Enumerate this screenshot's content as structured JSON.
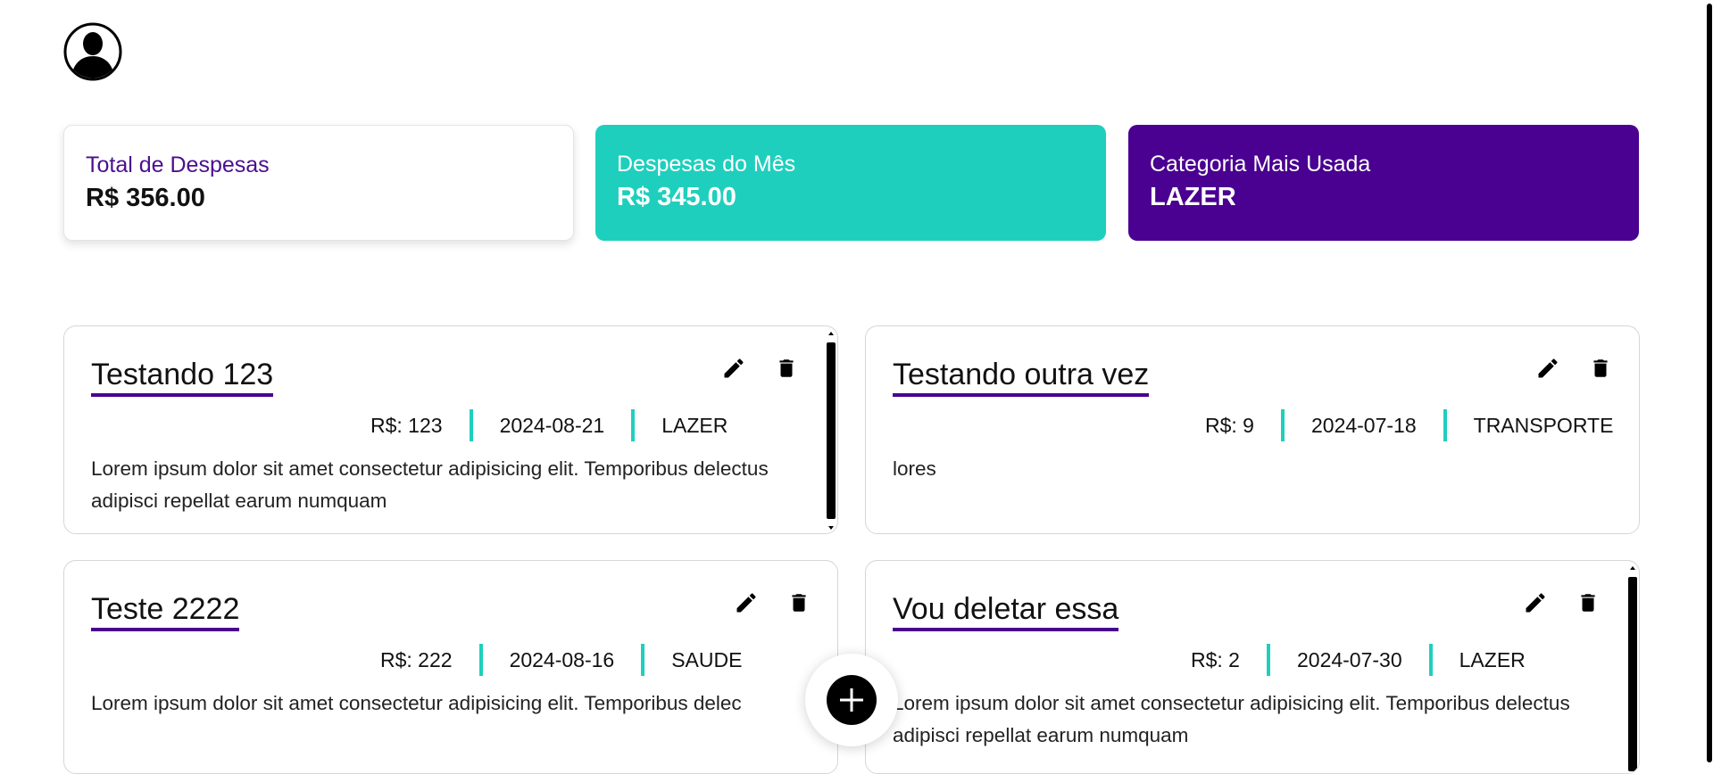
{
  "user": {
    "avatar_icon": "user-avatar-icon"
  },
  "summary": {
    "total": {
      "label": "Total de Despesas",
      "value": "R$ 356.00"
    },
    "month": {
      "label": "Despesas do Mês",
      "value": "R$ 345.00"
    },
    "category": {
      "label": "Categoria Mais Usada",
      "value": "LAZER"
    }
  },
  "expenses": [
    {
      "title": "Testando 123",
      "amount": "R$: 123",
      "date": "2024-08-21",
      "category": "LAZER",
      "description": "Lorem ipsum dolor sit amet consectetur adipisicing elit. Temporibus delectus adipisci repellat earum numquam"
    },
    {
      "title": "Testando outra vez",
      "amount": "R$: 9",
      "date": "2024-07-18",
      "category": "TRANSPORTE",
      "description": "lores"
    },
    {
      "title": "Teste 2222",
      "amount": "R$: 222",
      "date": "2024-08-16",
      "category": "SAUDE",
      "description": "Lorem ipsum dolor sit amet consectetur adipisicing elit. Temporibus delec"
    },
    {
      "title": "Vou deletar essa",
      "amount": "R$: 2",
      "date": "2024-07-30",
      "category": "LAZER",
      "description": "Lorem ipsum dolor sit amet consectetur adipisicing elit. Temporibus delectus adipisci repellat earum numquam"
    }
  ],
  "icons": {
    "edit": "pencil-icon",
    "delete": "trash-icon",
    "add": "plus-icon"
  },
  "colors": {
    "accent_teal": "#1fcfbd",
    "accent_purple": "#4a0090"
  }
}
